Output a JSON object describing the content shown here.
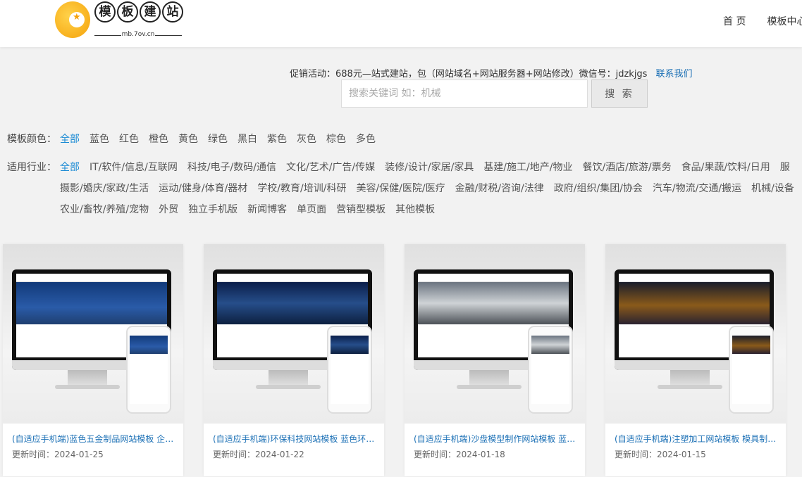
{
  "header": {
    "logo_text": [
      "模",
      "板",
      "建",
      "站"
    ],
    "logo_sub": "mb.7ov.cn",
    "nav": [
      "首 页",
      "模板中心"
    ]
  },
  "promo": {
    "text": "促销活动：688元—站式建站，包（网站域名+网站服务器+网站修改）微信号：jdzkjgs",
    "contact_link": "联系我们"
  },
  "search": {
    "placeholder": "搜索关键词 如：机械",
    "button": "搜 索"
  },
  "color_filter": {
    "label": "模板颜色：",
    "options": [
      "全部",
      "蓝色",
      "红色",
      "橙色",
      "黄色",
      "绿色",
      "黑白",
      "紫色",
      "灰色",
      "棕色",
      "多色"
    ],
    "active": "全部"
  },
  "industry_filter": {
    "label": "适用行业：",
    "options": [
      "全部",
      "IT/软件/信息/互联网",
      "科技/电子/数码/通信",
      "文化/艺术/广告/传媒",
      "装修/设计/家居/家具",
      "基建/施工/地产/物业",
      "餐饮/酒店/旅游/票务",
      "食品/果蔬/饮料/日用",
      "服",
      "摄影/婚庆/家政/生活",
      "运动/健身/体育/器材",
      "学校/教育/培训/科研",
      "美容/保健/医院/医疗",
      "金融/财税/咨询/法律",
      "政府/组织/集团/协会",
      "汽车/物流/交通/搬运",
      "机械/设备",
      "农业/畜牧/养殖/宠物",
      "外贸",
      "独立手机版",
      "新闻博客",
      "单页面",
      "营销型模板",
      "其他模板"
    ],
    "active": "全部"
  },
  "templates": [
    {
      "title": "(自适应手机端)蓝色五金制品网站模板 企业网站",
      "date_label": "更新时间：",
      "date": "2024-01-25",
      "theme": "b1"
    },
    {
      "title": "(自适应手机端)环保科技网站模板 蓝色环保网站",
      "date_label": "更新时间：",
      "date": "2024-01-22",
      "theme": "b2"
    },
    {
      "title": "(自适应手机端)沙盘模型制作网站模板 蓝色网站",
      "date_label": "更新时间：",
      "date": "2024-01-18",
      "theme": "b3"
    },
    {
      "title": "(自适应手机端)注塑加工网站模板 模具制造网站",
      "date_label": "更新时间：",
      "date": "2024-01-15",
      "theme": "b4"
    }
  ]
}
